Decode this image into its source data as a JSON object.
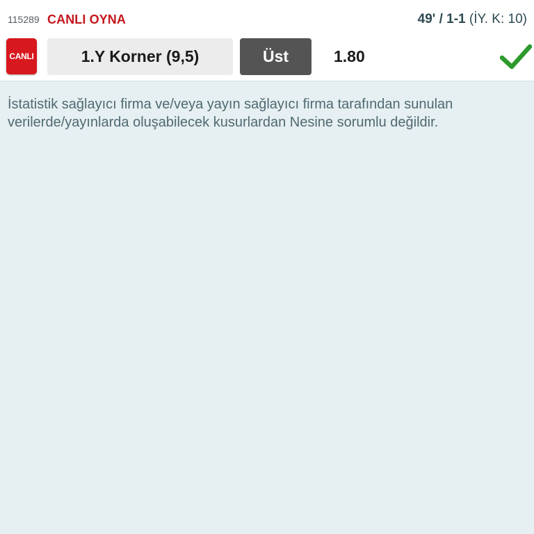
{
  "header": {
    "match_code": "115289",
    "live_play_label": "CANLI OYNA",
    "score_main": "49' / 1-1",
    "score_detail": "(İY. K: 10)"
  },
  "selection": {
    "badge": "CANLI",
    "market": "1.Y Korner (9,5)",
    "pick": "Üst",
    "odds": "1.80",
    "status_icon": "check-icon",
    "status_color": "#2c9a2c"
  },
  "disclaimer": {
    "text": "İstatistik sağlayıcı firma ve/veya yayın sağlayıcı firma tarafından sunulan verilerde/yayınlarda oluşabilecek kusurlardan Nesine sorumlu değildir."
  },
  "colors": {
    "brand_red": "#c4161c",
    "background": "#e6eff1"
  }
}
